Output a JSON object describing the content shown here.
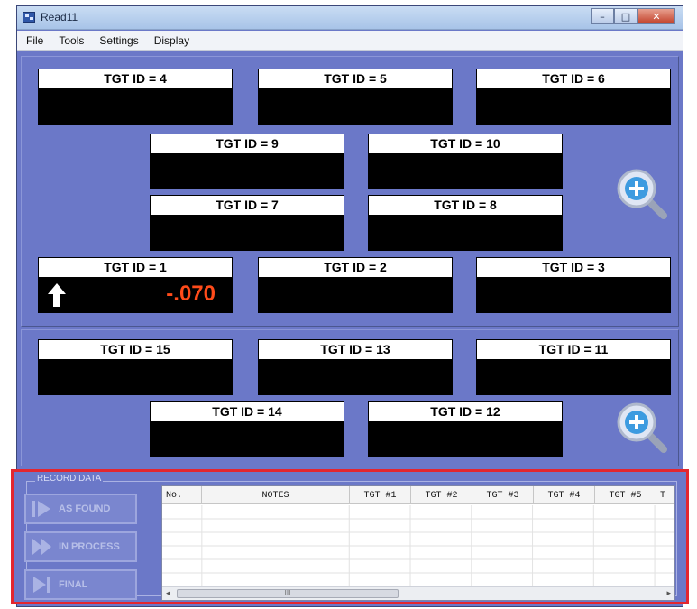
{
  "window": {
    "title": "Read11",
    "controls": {
      "minimize": "–",
      "maximize": "□",
      "close": "✕"
    }
  },
  "menu": [
    "File",
    "Tools",
    "Settings",
    "Display"
  ],
  "top_panel": {
    "targets": [
      {
        "label": "TGT ID = 4",
        "value": ""
      },
      {
        "label": "TGT ID = 5",
        "value": ""
      },
      {
        "label": "TGT ID = 6",
        "value": ""
      },
      {
        "label": "TGT ID = 9",
        "value": ""
      },
      {
        "label": "TGT ID = 10",
        "value": ""
      },
      {
        "label": "TGT ID = 7",
        "value": ""
      },
      {
        "label": "TGT ID = 8",
        "value": ""
      },
      {
        "label": "TGT ID = 1",
        "value": "-.070",
        "indicator": "arrow-up-icon"
      },
      {
        "label": "TGT ID = 2",
        "value": ""
      },
      {
        "label": "TGT ID = 3",
        "value": ""
      }
    ],
    "zoom_icon": "zoom-in-icon"
  },
  "bottom_panel": {
    "targets": [
      {
        "label": "TGT ID = 15",
        "value": ""
      },
      {
        "label": "TGT ID = 13",
        "value": ""
      },
      {
        "label": "TGT ID = 11",
        "value": ""
      },
      {
        "label": "TGT ID = 14",
        "value": ""
      },
      {
        "label": "TGT ID = 12",
        "value": ""
      }
    ],
    "zoom_icon": "zoom-in-icon"
  },
  "record_data": {
    "legend": "RECORD DATA",
    "buttons": [
      "AS FOUND",
      "IN PROCESS",
      "FINAL"
    ],
    "columns": [
      "No.",
      "NOTES",
      "TGT #1",
      "TGT #2",
      "TGT #3",
      "TGT #4",
      "TGT #5",
      "T"
    ],
    "scroll_thumb": "III",
    "highlight_color": "#e3262f"
  },
  "colors": {
    "background": "#6b78c8",
    "readout": "#ff4b1a",
    "display": "#000000"
  }
}
